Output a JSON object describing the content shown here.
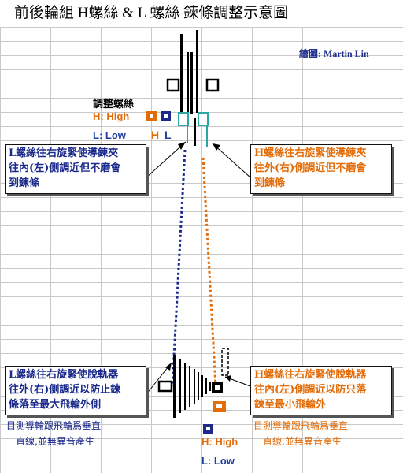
{
  "title": "前後輪組 H螺絲 & L 螺絲 鍊條調整示意圖",
  "credit": "繪圖: Martin Lin",
  "adjust_screw_label": "調整螺絲",
  "top_labels": {
    "high": "H: High",
    "low": "L: Low",
    "h_letter": "H",
    "l_letter": "L"
  },
  "notes": {
    "front_l": "L螺絲往右旋緊使導鍊夾\n往內(左)側調近但不磨會\n到鍊條",
    "front_h": "H螺絲往右旋緊使導鍊夾\n往外(右)側調近但不磨會\n到鍊條",
    "rear_l": "L螺絲往右旋緊使脫軌器\n往外(右)側調近以防止鍊\n條落至最大飛輪外側",
    "rear_h": "H螺絲往右旋緊使脫軌器\n往內(左)側調近以防只落\n鍊至最小飛輪外"
  },
  "hints": {
    "left": "目測導輪跟飛輪爲垂直\n一直線,並無異音產生",
    "right": "目測導輪跟飛輪爲垂直\n一直線,並無異音產生"
  },
  "bottom_labels": {
    "high": "H: High",
    "low": "L: Low"
  },
  "colors": {
    "orange": "#e36c09",
    "blue": "#1c2a8c",
    "teal": "#2aa7a3",
    "black": "#000000"
  }
}
